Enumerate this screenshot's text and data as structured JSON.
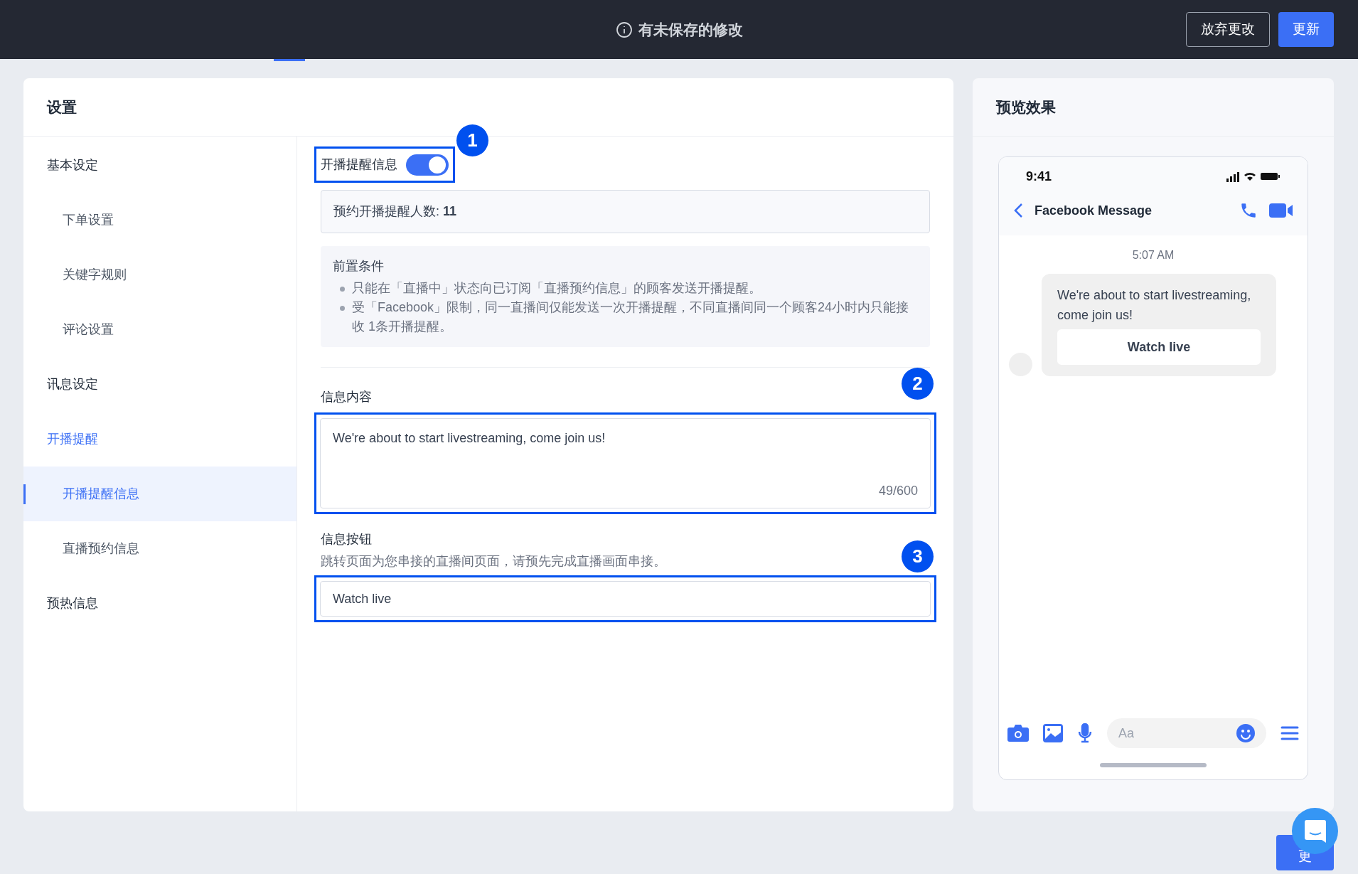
{
  "top_bar": {
    "notice": "有未保存的修改",
    "buttons": [
      {
        "label": "放弃更改",
        "kind": "outline"
      },
      {
        "label": "更新",
        "kind": "primary"
      }
    ]
  },
  "settings": {
    "title": "设置",
    "sidebar": [
      {
        "label": "基本设定",
        "selected": false,
        "children": [
          {
            "label": "下单设置",
            "selected": false
          },
          {
            "label": "关键字规则",
            "selected": false
          },
          {
            "label": "评论设置",
            "selected": false
          }
        ]
      },
      {
        "label": "讯息设定",
        "selected": false
      },
      {
        "label": "开播提醒",
        "selected": true,
        "children": [
          {
            "label": "开播提醒信息",
            "selected": true
          },
          {
            "label": "直播预约信息",
            "selected": false
          }
        ]
      },
      {
        "label": "预热信息",
        "selected": false
      }
    ],
    "toggle": {
      "label": "开播提醒信息",
      "on": true,
      "callout": "1"
    },
    "subscriber_count": {
      "label": "预约开播提醒人数:",
      "value": "11"
    },
    "prerequisites": {
      "title": "前置条件",
      "items": [
        "只能在「直播中」状态向已订阅「直播预约信息」的顾客发送开播提醒。",
        "受「Facebook」限制，同一直播间仅能发送一次开播提醒，不同直播间同一个顾客24小时内只能接收 1条开播提醒。"
      ]
    },
    "message_content": {
      "label": "信息内容",
      "value": "We're about to start livestreaming, come join us!",
      "counter": "49/600",
      "callout": "2"
    },
    "message_button": {
      "label": "信息按钮",
      "hint": "跳转页面为您串接的直播间页面，请预先完成直播画面串接。",
      "value": "Watch live",
      "callout": "3"
    }
  },
  "preview": {
    "title": "预览效果",
    "phone": {
      "time": "9:41",
      "chat_title": "Facebook Message",
      "timestamp": "5:07 AM",
      "message": "We're about to start livestreaming, come join us!",
      "button": "Watch live",
      "input_placeholder": "Aa"
    }
  },
  "footer_button": "更"
}
